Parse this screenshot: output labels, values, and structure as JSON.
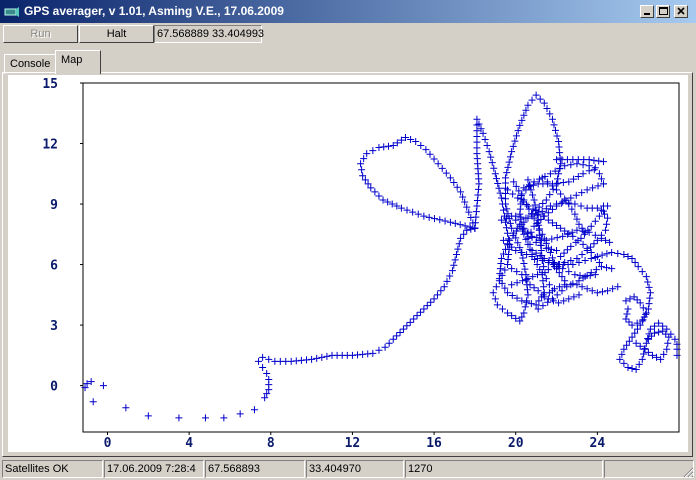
{
  "window": {
    "title": "GPS averager, v 1.01, Asming V.E., 17.06.2009"
  },
  "toolbar": {
    "run_label": "Run",
    "halt_label": "Halt",
    "coords_value": "67.568889 33.404993"
  },
  "tabs": [
    {
      "label": "Console"
    },
    {
      "label": "Map"
    }
  ],
  "chart_data": {
    "type": "scatter",
    "marker": "+",
    "color": "#0000cc",
    "xlim": [
      -1.2,
      28
    ],
    "ylim": [
      -2.3,
      15
    ],
    "x_ticks": [
      "0",
      "4",
      "8",
      "12",
      "16",
      "20",
      "24"
    ],
    "y_ticks": [
      "15",
      "12",
      "9",
      "6",
      "3",
      "0"
    ],
    "grid": false,
    "paths": [
      [
        [
          -1.0,
          0.1
        ],
        [
          -1.1,
          -0.1
        ],
        [
          -0.8,
          0.2
        ],
        [
          -0.7,
          -0.8
        ],
        [
          -0.2,
          0.0
        ],
        [
          0.9,
          -1.1
        ],
        [
          2.0,
          -1.5
        ],
        [
          3.5,
          -1.6
        ],
        [
          4.8,
          -1.6
        ],
        [
          5.7,
          -1.6
        ],
        [
          6.5,
          -1.4
        ],
        [
          7.2,
          -1.2
        ],
        [
          7.7,
          -0.6
        ],
        [
          7.9,
          -0.2
        ],
        [
          7.9,
          0.3
        ],
        [
          7.8,
          0.6
        ],
        [
          7.6,
          0.9
        ],
        [
          7.4,
          1.2
        ],
        [
          7.6,
          1.4
        ],
        [
          8.2,
          1.2
        ],
        [
          9.0,
          1.2
        ],
        [
          10.0,
          1.3
        ],
        [
          11.0,
          1.5
        ],
        [
          12.0,
          1.5
        ],
        [
          13.0,
          1.6
        ],
        [
          13.6,
          1.9
        ],
        [
          14.0,
          2.3
        ],
        [
          14.5,
          2.8
        ],
        [
          15.0,
          3.3
        ],
        [
          15.5,
          3.8
        ],
        [
          16.0,
          4.3
        ],
        [
          16.5,
          4.9
        ],
        [
          16.9,
          5.7
        ],
        [
          17.1,
          6.5
        ],
        [
          17.3,
          7.3
        ],
        [
          17.6,
          7.7
        ],
        [
          18.0,
          7.8
        ]
      ],
      [
        [
          18.0,
          7.8
        ],
        [
          16.8,
          8.1
        ],
        [
          15.5,
          8.4
        ],
        [
          14.4,
          8.8
        ],
        [
          13.5,
          9.2
        ],
        [
          12.9,
          9.8
        ],
        [
          12.5,
          10.4
        ],
        [
          12.4,
          11.0
        ],
        [
          12.7,
          11.5
        ],
        [
          13.3,
          11.8
        ],
        [
          14.0,
          11.9
        ],
        [
          14.6,
          12.3
        ],
        [
          15.1,
          12.1
        ],
        [
          15.6,
          11.7
        ],
        [
          16.2,
          11.0
        ],
        [
          16.8,
          10.3
        ],
        [
          17.3,
          9.6
        ],
        [
          17.7,
          8.6
        ],
        [
          18.0,
          7.8
        ]
      ],
      [
        [
          18.0,
          7.8
        ],
        [
          18.2,
          10.0
        ],
        [
          18.1,
          11.5
        ],
        [
          18.1,
          13.2
        ],
        [
          18.4,
          12.5
        ],
        [
          18.7,
          11.6
        ],
        [
          19.0,
          10.5
        ],
        [
          19.3,
          9.3
        ],
        [
          19.5,
          8.1
        ],
        [
          19.7,
          7.0
        ],
        [
          19.6,
          6.0
        ],
        [
          19.2,
          5.2
        ],
        [
          18.9,
          4.6
        ],
        [
          19.1,
          4.0
        ],
        [
          19.6,
          3.6
        ],
        [
          20.2,
          3.2
        ],
        [
          20.4,
          3.6
        ],
        [
          20.6,
          4.5
        ],
        [
          20.5,
          5.5
        ],
        [
          20.3,
          6.6
        ],
        [
          19.8,
          7.8
        ],
        [
          19.5,
          9.0
        ],
        [
          19.5,
          10.3
        ],
        [
          19.8,
          11.6
        ],
        [
          20.2,
          12.9
        ],
        [
          20.6,
          13.9
        ],
        [
          21.0,
          14.4
        ],
        [
          21.4,
          14.0
        ],
        [
          21.8,
          13.2
        ],
        [
          22.1,
          12.1
        ],
        [
          22.2,
          11.0
        ],
        [
          22.0,
          10.0
        ],
        [
          21.5,
          9.2
        ],
        [
          20.8,
          8.5
        ],
        [
          20.2,
          7.9
        ],
        [
          19.7,
          7.2
        ],
        [
          19.3,
          6.3
        ],
        [
          19.2,
          5.3
        ],
        [
          19.6,
          4.6
        ],
        [
          20.3,
          4.2
        ],
        [
          21.0,
          4.0
        ],
        [
          21.4,
          4.6
        ],
        [
          21.3,
          5.5
        ],
        [
          20.8,
          6.5
        ],
        [
          20.4,
          7.5
        ],
        [
          20.2,
          8.5
        ],
        [
          20.3,
          9.5
        ],
        [
          20.9,
          10.1
        ],
        [
          21.7,
          10.5
        ],
        [
          22.4,
          10.9
        ],
        [
          23.0,
          11.0
        ],
        [
          23.6,
          10.9
        ],
        [
          24.1,
          10.5
        ],
        [
          24.3,
          10.0
        ]
      ],
      [
        [
          24.3,
          10.0
        ],
        [
          23.5,
          9.7
        ],
        [
          22.7,
          9.3
        ],
        [
          22.0,
          8.9
        ],
        [
          21.4,
          8.4
        ],
        [
          20.9,
          7.9
        ],
        [
          20.6,
          7.3
        ],
        [
          20.8,
          6.7
        ],
        [
          21.4,
          6.3
        ],
        [
          22.1,
          6.0
        ],
        [
          22.8,
          6.0
        ],
        [
          23.4,
          6.2
        ],
        [
          24.0,
          6.4
        ],
        [
          24.7,
          6.6
        ],
        [
          25.3,
          6.5
        ],
        [
          25.7,
          6.3
        ],
        [
          26.0,
          5.9
        ],
        [
          26.4,
          5.4
        ],
        [
          26.6,
          4.6
        ],
        [
          26.5,
          3.8
        ],
        [
          26.1,
          3.0
        ],
        [
          25.7,
          2.4
        ],
        [
          25.3,
          1.8
        ],
        [
          25.1,
          1.3
        ],
        [
          25.5,
          0.9
        ],
        [
          25.9,
          0.8
        ],
        [
          26.2,
          1.3
        ],
        [
          26.4,
          2.1
        ],
        [
          26.6,
          2.8
        ],
        [
          27.0,
          3.1
        ],
        [
          27.4,
          2.8
        ],
        [
          27.8,
          2.3
        ],
        [
          28.0,
          1.8
        ],
        [
          28.1,
          1.5
        ]
      ],
      [
        [
          20.0,
          8.4
        ],
        [
          20.5,
          8.3
        ],
        [
          21.1,
          8.5
        ],
        [
          21.7,
          8.9
        ],
        [
          22.3,
          9.1
        ],
        [
          22.9,
          9.0
        ],
        [
          23.5,
          8.8
        ],
        [
          24.0,
          8.8
        ],
        [
          24.3,
          8.9
        ]
      ],
      [
        [
          20.1,
          7.8
        ],
        [
          20.8,
          7.4
        ],
        [
          21.5,
          7.2
        ],
        [
          22.3,
          7.4
        ],
        [
          23.0,
          7.7
        ],
        [
          23.6,
          7.6
        ],
        [
          24.2,
          7.3
        ],
        [
          24.6,
          7.1
        ]
      ],
      [
        [
          19.4,
          7.2
        ],
        [
          20.0,
          6.7
        ],
        [
          20.8,
          6.4
        ],
        [
          21.6,
          6.1
        ],
        [
          22.3,
          5.8
        ],
        [
          22.9,
          5.5
        ],
        [
          23.4,
          5.4
        ],
        [
          23.9,
          5.5
        ]
      ],
      [
        [
          19.8,
          5.0
        ],
        [
          20.6,
          5.3
        ],
        [
          21.3,
          5.6
        ],
        [
          21.9,
          5.9
        ],
        [
          22.4,
          6.1
        ],
        [
          23.0,
          6.3
        ],
        [
          23.5,
          6.7
        ],
        [
          24.0,
          7.2
        ],
        [
          24.4,
          7.7
        ],
        [
          24.5,
          8.3
        ],
        [
          24.2,
          8.7
        ]
      ],
      [
        [
          21.4,
          4.4
        ],
        [
          21.9,
          4.8
        ],
        [
          22.4,
          5.0
        ],
        [
          23.0,
          5.0
        ],
        [
          23.5,
          4.8
        ],
        [
          24.0,
          4.6
        ],
        [
          24.5,
          4.7
        ],
        [
          25.0,
          4.9
        ]
      ],
      [
        [
          21.1,
          3.8
        ],
        [
          21.8,
          4.3
        ],
        [
          22.5,
          4.9
        ],
        [
          23.1,
          5.2
        ],
        [
          23.7,
          5.6
        ],
        [
          24.2,
          5.9
        ],
        [
          24.7,
          5.8
        ]
      ],
      [
        [
          22.0,
          11.2
        ],
        [
          22.8,
          11.2
        ],
        [
          23.6,
          11.2
        ],
        [
          24.3,
          11.1
        ]
      ],
      [
        [
          20.4,
          9.8
        ],
        [
          21.1,
          10.0
        ],
        [
          21.8,
          10.0
        ],
        [
          22.6,
          10.1
        ],
        [
          23.3,
          10.5
        ],
        [
          23.9,
          10.8
        ]
      ],
      [
        [
          19.6,
          9.7
        ],
        [
          20.1,
          9.3
        ],
        [
          20.6,
          8.9
        ],
        [
          21.1,
          8.6
        ],
        [
          21.6,
          8.2
        ],
        [
          22.2,
          7.8
        ],
        [
          22.8,
          7.4
        ],
        [
          23.3,
          7.0
        ],
        [
          23.7,
          6.6
        ],
        [
          24.1,
          6.1
        ]
      ],
      [
        [
          19.9,
          10.1
        ],
        [
          20.4,
          9.2
        ],
        [
          20.9,
          8.3
        ],
        [
          21.3,
          7.5
        ],
        [
          21.7,
          6.6
        ],
        [
          22.0,
          5.8
        ],
        [
          22.4,
          5.2
        ]
      ],
      [
        [
          20.6,
          10.2
        ],
        [
          20.9,
          9.2
        ],
        [
          21.1,
          8.2
        ],
        [
          21.2,
          7.2
        ],
        [
          21.3,
          6.2
        ],
        [
          21.5,
          5.3
        ],
        [
          21.8,
          4.7
        ]
      ],
      [
        [
          19.3,
          8.2
        ],
        [
          19.8,
          8.4
        ],
        [
          20.2,
          8.0
        ],
        [
          20.6,
          7.6
        ],
        [
          21.0,
          7.1
        ],
        [
          21.5,
          6.8
        ],
        [
          22.0,
          6.7
        ]
      ],
      [
        [
          21.3,
          10.3
        ],
        [
          21.8,
          9.9
        ],
        [
          22.2,
          9.5
        ],
        [
          22.6,
          9.0
        ],
        [
          22.9,
          8.5
        ],
        [
          23.1,
          8.0
        ],
        [
          23.4,
          7.6
        ]
      ],
      [
        [
          25.4,
          4.2
        ],
        [
          25.8,
          4.4
        ],
        [
          26.1,
          4.1
        ],
        [
          26.4,
          3.6
        ],
        [
          26.2,
          3.2
        ],
        [
          25.7,
          3.0
        ],
        [
          25.4,
          3.3
        ],
        [
          25.5,
          3.8
        ]
      ],
      [
        [
          25.9,
          2.1
        ],
        [
          26.3,
          1.8
        ],
        [
          26.7,
          1.5
        ],
        [
          27.1,
          1.3
        ],
        [
          27.4,
          1.8
        ],
        [
          27.5,
          2.4
        ],
        [
          27.2,
          2.7
        ],
        [
          26.8,
          2.6
        ],
        [
          26.5,
          2.3
        ]
      ],
      [
        [
          19.8,
          5.8
        ],
        [
          20.3,
          5.5
        ],
        [
          20.7,
          5.0
        ],
        [
          21.1,
          4.7
        ],
        [
          21.6,
          4.3
        ],
        [
          22.1,
          4.1
        ],
        [
          22.6,
          4.3
        ],
        [
          23.1,
          4.5
        ]
      ],
      [
        [
          22.2,
          6.4
        ],
        [
          22.7,
          6.9
        ],
        [
          23.2,
          7.3
        ],
        [
          23.7,
          7.9
        ],
        [
          24.1,
          8.4
        ],
        [
          24.5,
          8.9
        ]
      ]
    ]
  },
  "status": {
    "satellites": "Satellites OK",
    "datetime": "17.06.2009  7:28:4",
    "lat": "67.568893",
    "lon": "33.404970",
    "count": "1270"
  }
}
